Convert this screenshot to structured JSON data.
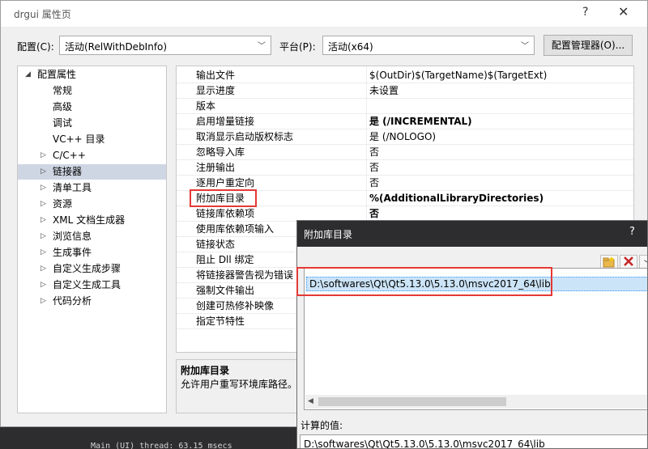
{
  "window": {
    "title": "drgui 属性页",
    "help_glyph": "?",
    "close_glyph": "✕"
  },
  "config": {
    "label": "配置(C):",
    "value": "活动(RelWithDebInfo)",
    "platform_label": "平台(P):",
    "platform_value": "活动(x64)",
    "manager_label": "配置管理器(O)..."
  },
  "tree": {
    "root": "配置属性",
    "items": [
      {
        "label": "常规",
        "expandable": false
      },
      {
        "label": "高级",
        "expandable": false
      },
      {
        "label": "调试",
        "expandable": false
      },
      {
        "label": "VC++ 目录",
        "expandable": false
      },
      {
        "label": "C/C++",
        "expandable": true
      },
      {
        "label": "链接器",
        "expandable": true,
        "selected": true
      },
      {
        "label": "清单工具",
        "expandable": true
      },
      {
        "label": "资源",
        "expandable": true
      },
      {
        "label": "XML 文档生成器",
        "expandable": true
      },
      {
        "label": "浏览信息",
        "expandable": true
      },
      {
        "label": "生成事件",
        "expandable": true
      },
      {
        "label": "自定义生成步骤",
        "expandable": true
      },
      {
        "label": "自定义生成工具",
        "expandable": true
      },
      {
        "label": "代码分析",
        "expandable": true
      }
    ]
  },
  "properties": [
    {
      "name": "输出文件",
      "value": "$(OutDir)$(TargetName)$(TargetExt)",
      "bold": false
    },
    {
      "name": "显示进度",
      "value": "未设置",
      "bold": false
    },
    {
      "name": "版本",
      "value": "",
      "bold": false
    },
    {
      "name": "启用增量链接",
      "value": "是 (/INCREMENTAL)",
      "bold": true
    },
    {
      "name": "取消显示启动版权标志",
      "value": "是 (/NOLOGO)",
      "bold": false
    },
    {
      "name": "忽略导入库",
      "value": "否",
      "bold": false
    },
    {
      "name": "注册输出",
      "value": "否",
      "bold": false
    },
    {
      "name": "逐用户重定向",
      "value": "否",
      "bold": false
    },
    {
      "name": "附加库目录",
      "value": "%(AdditionalLibraryDirectories)",
      "bold": true
    },
    {
      "name": "链接库依赖项",
      "value": "否",
      "bold": true
    },
    {
      "name": "使用库依赖项输入",
      "value": "",
      "bold": false
    },
    {
      "name": "链接状态",
      "value": "",
      "bold": false
    },
    {
      "name": "阻止 Dll 绑定",
      "value": "",
      "bold": false
    },
    {
      "name": "将链接器警告视为错误",
      "value": "",
      "bold": false
    },
    {
      "name": "强制文件输出",
      "value": "",
      "bold": false
    },
    {
      "name": "创建可热修补映像",
      "value": "",
      "bold": false
    },
    {
      "name": "指定节特性",
      "value": "",
      "bold": false
    }
  ],
  "description": {
    "title": "附加库目录",
    "text": "允许用户重写环境库路径。"
  },
  "dialog": {
    "title": "附加库目录",
    "help_glyph": "?",
    "toolbar": {
      "new_folder_icon": "new-folder-icon",
      "delete_icon": "delete-icon",
      "move_down_icon": "move-down-icon"
    },
    "directory": "D:\\softwares\\Qt\\Qt5.13.0\\5.13.0\\msvc2017_64\\lib",
    "evaluated_label": "计算的值:",
    "evaluated_value": "D:\\softwares\\Qt\\Qt5.13.0\\5.13.0\\msvc2017_64\\lib"
  },
  "console_text": "Main (UI) thread: 63.15 msecs",
  "colors": {
    "highlight": "#e53935",
    "selection": "#cce4f7",
    "tree_selection": "#cfd6e3",
    "dialog_titlebar": "#2d2d30"
  }
}
